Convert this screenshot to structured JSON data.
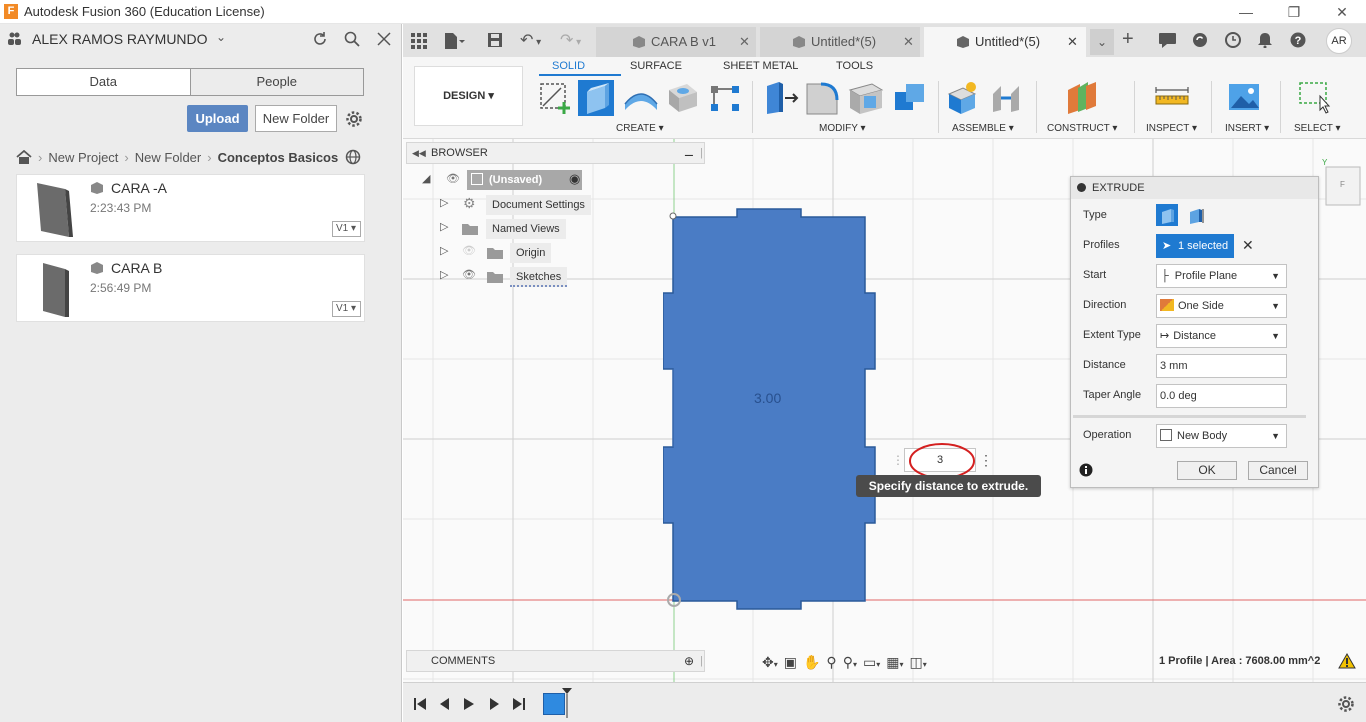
{
  "window": {
    "title": "Autodesk Fusion 360 (Education License)",
    "app_icon": "F"
  },
  "user": {
    "name": "ALEX RAMOS RAYMUNDO",
    "avatar": "AR"
  },
  "data_panel": {
    "tabs": [
      "Data",
      "People"
    ],
    "upload_label": "Upload",
    "new_folder_label": "New Folder",
    "breadcrumb": [
      "New Project",
      "New Folder",
      "Conceptos Basicos"
    ],
    "files": [
      {
        "name": "CARA -A",
        "time": "2:23:43 PM",
        "version": "V1"
      },
      {
        "name": "CARA B",
        "time": "2:56:49 PM",
        "version": "V1"
      }
    ]
  },
  "doc_tabs": [
    {
      "label": "CARA B v1",
      "active": false
    },
    {
      "label": "Untitled*(5)",
      "active": false
    },
    {
      "label": "Untitled*(5)",
      "active": true
    }
  ],
  "toolbar": {
    "workspace": "DESIGN",
    "tabs": [
      "SOLID",
      "SURFACE",
      "SHEET METAL",
      "TOOLS"
    ],
    "active_tab": "SOLID",
    "groups": [
      "CREATE",
      "MODIFY",
      "ASSEMBLE",
      "CONSTRUCT",
      "INSPECT",
      "INSERT",
      "SELECT"
    ]
  },
  "browser": {
    "title": "BROWSER",
    "root": "(Unsaved)",
    "items": [
      "Document Settings",
      "Named Views",
      "Origin",
      "Sketches"
    ]
  },
  "canvas": {
    "dimension_label": "3.00",
    "distance_input": "3",
    "tooltip": "Specify distance to extrude."
  },
  "extrude": {
    "title": "EXTRUDE",
    "rows": {
      "type": "Type",
      "profiles": "Profiles",
      "profiles_value": "1 selected",
      "start": "Start",
      "start_value": "Profile Plane",
      "direction": "Direction",
      "direction_value": "One Side",
      "extent_type": "Extent Type",
      "extent_value": "Distance",
      "distance": "Distance",
      "distance_value": "3 mm",
      "taper": "Taper Angle",
      "taper_value": "0.0 deg",
      "operation": "Operation",
      "operation_value": "New Body"
    },
    "ok": "OK",
    "cancel": "Cancel"
  },
  "comments": {
    "title": "COMMENTS"
  },
  "status": {
    "text": "1 Profile | Area : 7608.00 mm^2"
  },
  "colors": {
    "accent": "#1f7ad1",
    "profile_fill": "#4a7cc5",
    "upload": "#5b86c2"
  }
}
